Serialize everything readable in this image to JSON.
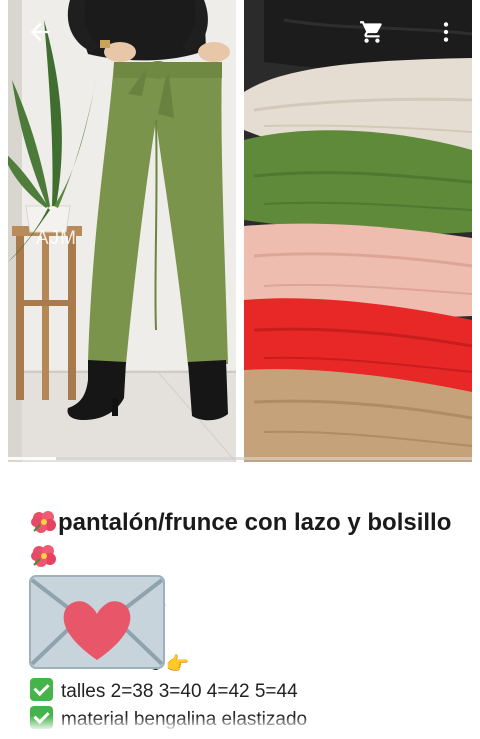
{
  "gallery": {
    "watermark": "AJM",
    "colors": [
      "#1c1c1c",
      "#e6ddd2",
      "#5f8a3a",
      "#eebdb0",
      "#e82827",
      "#c6a27a"
    ]
  },
  "toolbar": {
    "back_icon": "arrow-left-icon",
    "cart_icon": "shopping-cart-icon",
    "more_icon": "more-vertical-icon"
  },
  "product": {
    "title": "pantalón/frunce con lazo y bolsillo",
    "title_emoji": "hibiscus",
    "partial_line_1": ")",
    "partial_line_2": "e 👉",
    "details": [
      "talles 2=38  3=40 4=42  5=44",
      "material bengalina elastizado"
    ]
  },
  "sticker": "love-letter-icon"
}
